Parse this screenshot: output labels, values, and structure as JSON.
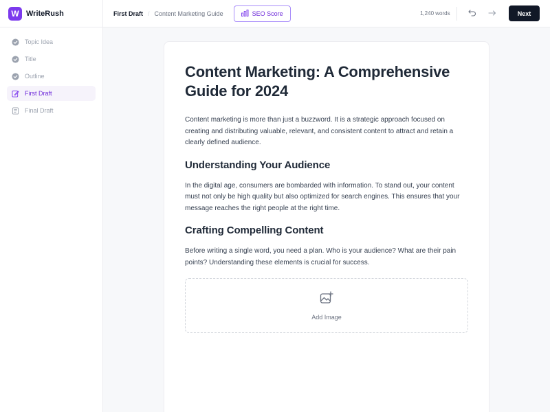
{
  "app": {
    "logo_letter": "W",
    "name": "WriteRush",
    "accent": "#7c3aed"
  },
  "sidebar": {
    "steps": [
      {
        "label": "Topic Idea",
        "icon": "check-circle-icon",
        "state": "done"
      },
      {
        "label": "Title",
        "icon": "check-circle-icon",
        "state": "done"
      },
      {
        "label": "Outline",
        "icon": "check-circle-icon",
        "state": "done"
      },
      {
        "label": "First Draft",
        "icon": "edit-icon",
        "state": "active"
      },
      {
        "label": "Final Draft",
        "icon": "document-icon",
        "state": "pending"
      }
    ]
  },
  "topbar": {
    "current_step": "First Draft",
    "separator": "/",
    "document_name": "Content Marketing Guide",
    "seo_label": "SEO Score",
    "word_count": "1,240 words",
    "next_label": "Next"
  },
  "document": {
    "title": "Content Marketing: A Comprehensive Guide for 2024",
    "intro": "Content marketing is more than just a buzzword. It is a strategic approach focused on creating and distributing valuable, relevant, and consistent content to attract and retain a clearly defined audience.",
    "section1_heading": "Understanding Your Audience",
    "section1_body": "In the digital age, consumers are bombarded with information. To stand out, your content must not only be high quality but also optimized for search engines. This ensures that your message reaches the right people at the right time.",
    "section2_heading": "Crafting Compelling Content",
    "section2_body": "Before writing a single word, you need a plan. Who is your audience? What are their pain points? Understanding these elements is crucial for success.",
    "add_image_label": "Add Image"
  }
}
